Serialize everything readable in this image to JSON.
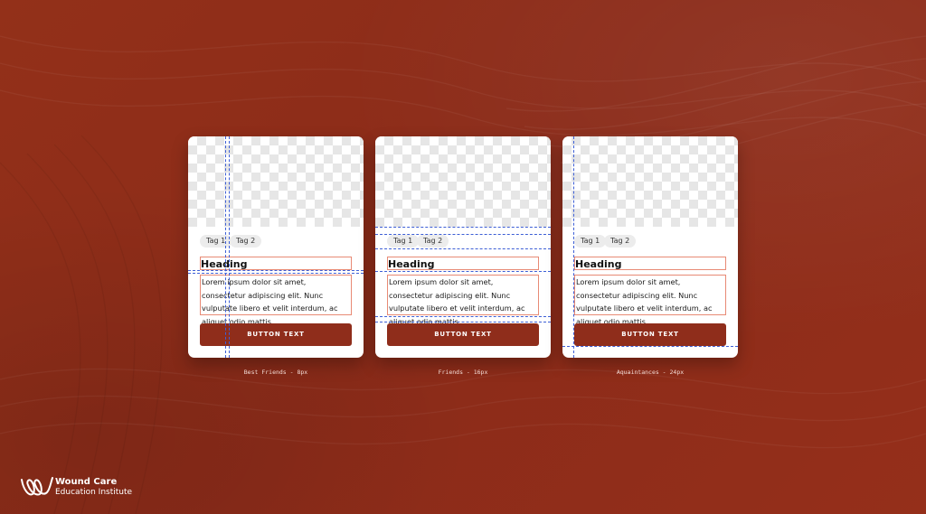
{
  "cards": [
    {
      "tags": [
        "Tag 1",
        "Tag 2"
      ],
      "heading": "Heading",
      "body": "Lorem ipsum dolor sit amet, consectetur adipiscing elit. Nunc vulputate libero et velit interdum, ac aliquet odio mattis.",
      "button": "BUTTON TEXT",
      "caption": "Best Friends - 8px"
    },
    {
      "tags": [
        "Tag 1",
        "Tag 2"
      ],
      "heading": "Heading",
      "body": "Lorem ipsum dolor sit amet, consectetur adipiscing elit. Nunc vulputate libero et velit interdum, ac aliquet odio mattis.",
      "button": "BUTTON TEXT",
      "caption": "Friends - 16px"
    },
    {
      "tags": [
        "Tag 1",
        "Tag 2"
      ],
      "heading": "Heading",
      "body": "Lorem ipsum dolor sit amet, consectetur adipiscing elit. Nunc vulputate libero et velit interdum, ac aliquet odio mattis.",
      "button": "BUTTON TEXT",
      "caption": "Aquaintances - 24px"
    }
  ],
  "brand": {
    "line1": "Wound Care",
    "line2": "Education Institute",
    "logo_icon": "wci-logo-icon"
  },
  "colors": {
    "background": "#8f2d1b",
    "button": "#8f2d1b",
    "guide": "#3d5fd6",
    "outline": "#e88a75"
  }
}
